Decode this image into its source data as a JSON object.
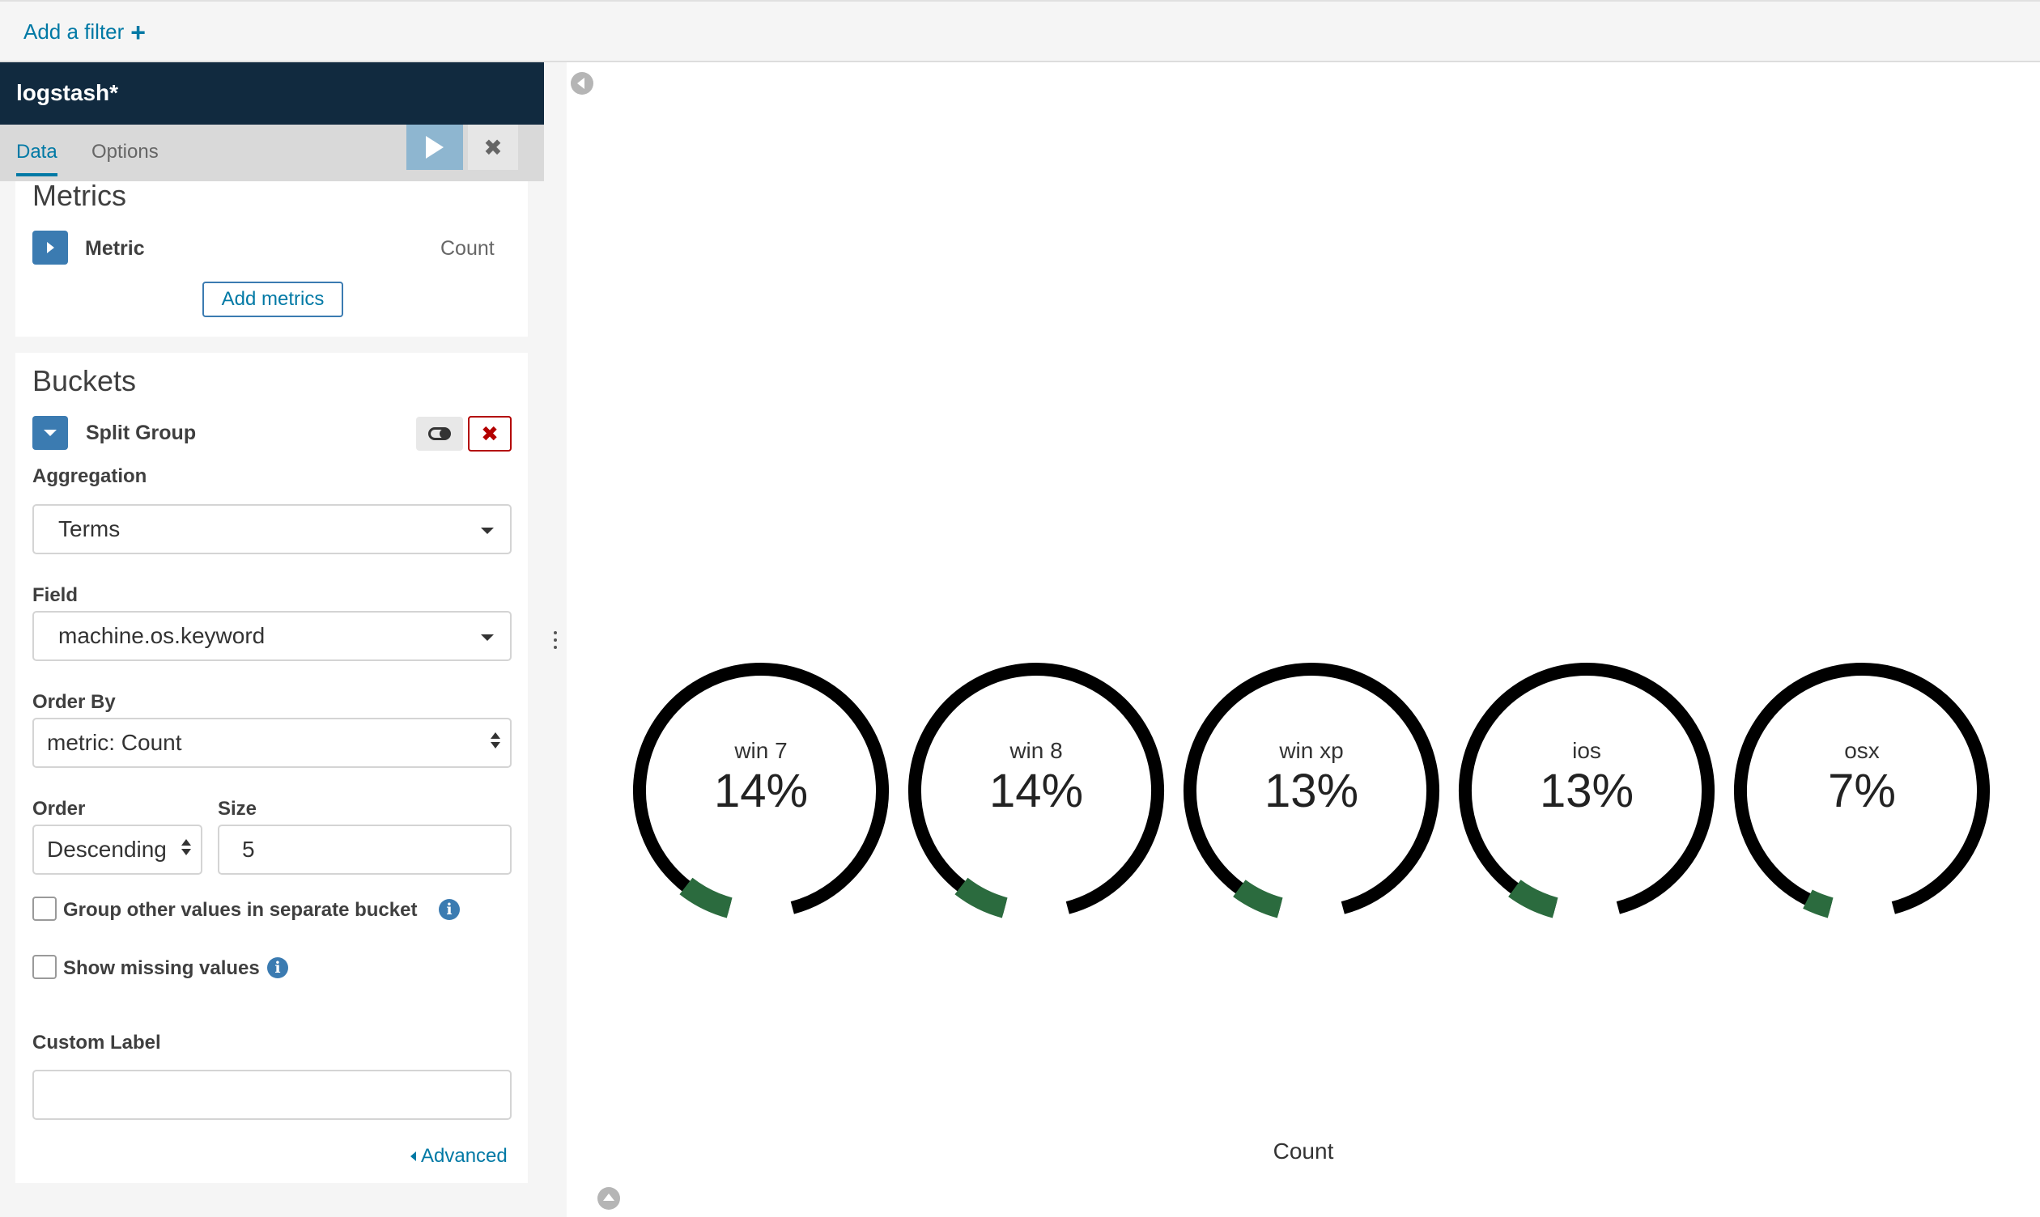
{
  "filter_bar": {
    "add_filter_label": "Add a filter"
  },
  "sidebar": {
    "index_pattern": "logstash*",
    "tabs": [
      {
        "label": "Data"
      },
      {
        "label": "Options"
      }
    ],
    "metrics": {
      "title": "Metrics",
      "agg_name": "Metric",
      "agg_desc": "Count",
      "add_button": "Add metrics"
    },
    "buckets": {
      "title": "Buckets",
      "agg_name": "Split Group",
      "aggregation": {
        "label": "Aggregation",
        "value": "Terms"
      },
      "field": {
        "label": "Field",
        "value": "machine.os.keyword"
      },
      "order_by": {
        "label": "Order By",
        "value": "metric: Count"
      },
      "order": {
        "label": "Order",
        "value": "Descending"
      },
      "size": {
        "label": "Size",
        "value": "5"
      },
      "group_other": {
        "label": "Group other values in separate bucket",
        "checked": false
      },
      "show_missing": {
        "label": "Show missing values",
        "checked": false
      },
      "custom_label": {
        "label": "Custom Label",
        "value": ""
      },
      "advanced_link": "Advanced"
    }
  },
  "vis": {
    "metric_label": "Count",
    "colors": {
      "arc_bg": "#000000",
      "arc_fill": "#2b6b3e"
    },
    "gauges": [
      {
        "label": "win 7",
        "value": 14,
        "display": "14%"
      },
      {
        "label": "win 8",
        "value": 14,
        "display": "14%"
      },
      {
        "label": "win xp",
        "value": 13,
        "display": "13%"
      },
      {
        "label": "ios",
        "value": 13,
        "display": "13%"
      },
      {
        "label": "osx",
        "value": 7,
        "display": "7%"
      }
    ]
  }
}
